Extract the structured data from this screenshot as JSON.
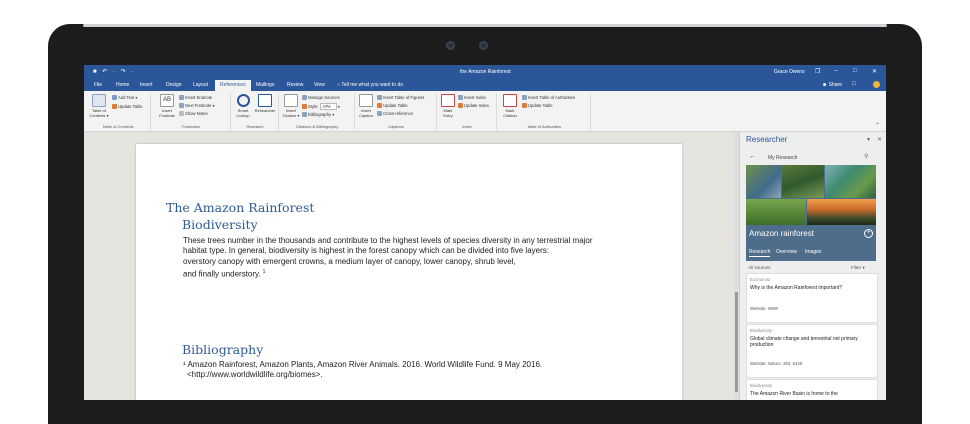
{
  "app": {
    "document_title": "the Amazon Rainforest",
    "user_name": "Grace Owens",
    "share_label": "Share",
    "quick_access": "■ ↶ · ↷ ·",
    "window_buttons": [
      "❐",
      "–",
      "□",
      "✕"
    ]
  },
  "tabs": [
    {
      "label": "File"
    },
    {
      "label": "Home"
    },
    {
      "label": "Insert"
    },
    {
      "label": "Design"
    },
    {
      "label": "Layout"
    },
    {
      "label": "References",
      "active": true
    },
    {
      "label": "Mailings"
    },
    {
      "label": "Review"
    },
    {
      "label": "View"
    }
  ],
  "tell_me": "Tell me what you want to do",
  "ribbon": {
    "groups": [
      {
        "label": "Table of Contents"
      },
      {
        "label": "Footnotes"
      },
      {
        "label": "Research"
      },
      {
        "label": "Citations & Bibliography"
      },
      {
        "label": "Captions"
      },
      {
        "label": "Index"
      },
      {
        "label": "Table of Authorities"
      }
    ],
    "toc": {
      "big": "Table of Contents ▾",
      "add_text": "Add Text ▾",
      "update": "Update Table"
    },
    "footnotes": {
      "big": "Insert Footnote",
      "endnote": "Insert Endnote",
      "next": "Next Footnote ▾",
      "show": "Show Notes"
    },
    "research": {
      "smart": "Smart Lookup",
      "researcher": "Researcher"
    },
    "citations": {
      "big": "Insert Citation ▾",
      "manage": "Manage Sources",
      "style_label": "Style:",
      "style_value": "APA",
      "bibliography": "Bibliography ▾"
    },
    "captions": {
      "big": "Insert Caption",
      "figures": "Insert Table of Figures",
      "update": "Update Table",
      "cross": "Cross-reference"
    },
    "index": {
      "big": "Mark Entry",
      "insert": "Insert Index",
      "update": "Update Index"
    },
    "authorities": {
      "big": "Mark Citation",
      "insert": "Insert Table of Authorities",
      "update": "Update Table"
    }
  },
  "document": {
    "title": "The Amazon Rainforest",
    "subtitle": "Biodiversity",
    "paragraph_lines": [
      "These trees number in the thousands and contribute to the highest levels of species diversity in any terrestrial major",
      "habitat type. In general, biodiversity is highest in the forest canopy which can be divided into five layers:",
      "overstory canopy with emergent crowns, a medium layer of canopy, lower canopy, shrub level,",
      "and finally understory."
    ],
    "footnote_ref": "1",
    "bibliography_heading": "Bibliography",
    "bibliography_lines": [
      "¹ Amazon Rainforest, Amazon Plants, Amazon River Animals. 2016. World Wildlife Fund. 9 May 2016.",
      "  <http://www.worldwildlife.org/biomes>."
    ]
  },
  "researcher": {
    "title": "Researcher",
    "back": "←",
    "my_research": "My Research",
    "topic": "Amazon rainforest",
    "tabs": [
      "Research",
      "Overview",
      "Images"
    ],
    "sources_label": "All sources",
    "filter_label": "Filter ▾",
    "results": [
      {
        "source": "Economist",
        "title": "Why is the Amazon Rainforest important?",
        "meta": "Website: WWF"
      },
      {
        "source": "Biodiversity",
        "title": "Global climate change and terrestrial net primary production",
        "meta": "Website: Nature. 363, 6426"
      },
      {
        "source": "Biodiversity",
        "title": "The Amazon River Basin is home to the",
        "meta": ""
      }
    ]
  },
  "colors": {
    "word_blue": "#2b579a",
    "heading_blue": "#2e5b95"
  }
}
